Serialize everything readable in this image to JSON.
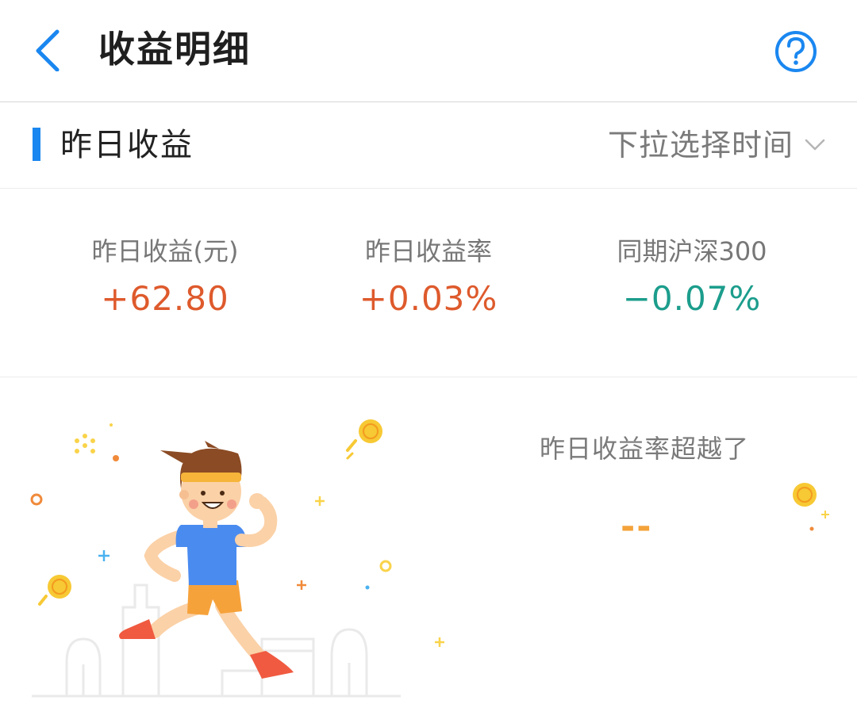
{
  "header": {
    "title": "收益明细",
    "back_icon": "chevron-left-icon",
    "help_icon": "question-circle-icon"
  },
  "section": {
    "title": "昨日收益",
    "date_picker_label": "下拉选择时间",
    "date_picker_icon": "chevron-down-icon"
  },
  "stats": [
    {
      "label": "昨日收益(元)",
      "value": "+62.80",
      "color": "#de5a2c"
    },
    {
      "label": "昨日收益率",
      "value": "+0.03%",
      "color": "#de5a2c"
    },
    {
      "label": "同期沪深300",
      "value": "−0.07%",
      "color": "#1c9d8c"
    }
  ],
  "ranking": {
    "label": "昨日收益率超越了",
    "value": "--"
  },
  "colors": {
    "accent": "#1a87f0",
    "gain": "#de5a2c",
    "loss": "#1c9d8c",
    "highlight": "#f4a23a"
  }
}
